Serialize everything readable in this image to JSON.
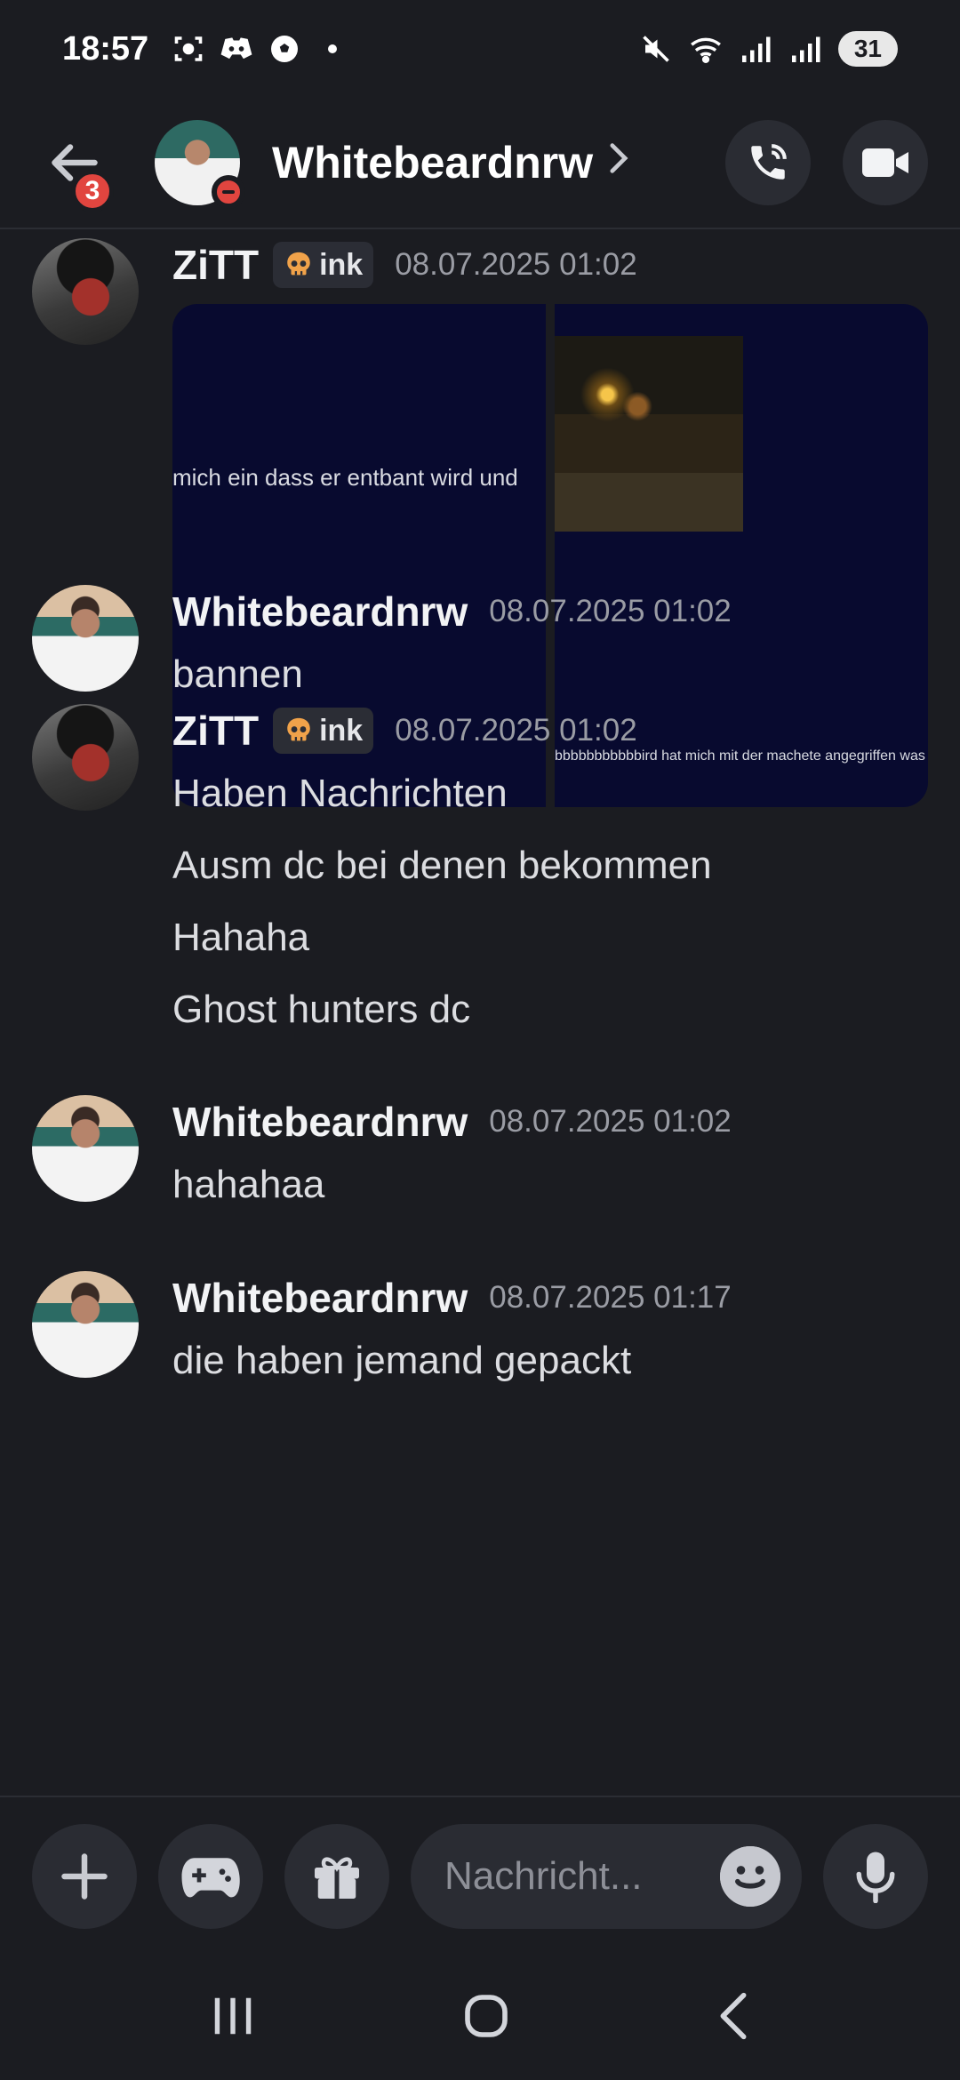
{
  "status_bar": {
    "time": "18:57",
    "battery": "31"
  },
  "header": {
    "title": "Whitebeardnrw",
    "unread_count": "3"
  },
  "messages": [
    {
      "author": "ZiTT",
      "tag": "ink",
      "timestamp": "08.07.2025 01:02",
      "images": [
        {
          "caption": "mich ein dass er entbant wird und"
        },
        {
          "caption": "bbbbbbbbbbbird hat mich mit der machete angegriffen was"
        }
      ]
    },
    {
      "author": "Whitebeardnrw",
      "timestamp": "08.07.2025 01:02",
      "lines": [
        "bannen"
      ]
    },
    {
      "author": "ZiTT",
      "tag": "ink",
      "timestamp": "08.07.2025 01:02",
      "lines": [
        "Haben Nachrichten",
        "Ausm dc bei denen bekommen",
        "Hahaha",
        "Ghost hunters dc"
      ]
    },
    {
      "author": "Whitebeardnrw",
      "timestamp": "08.07.2025 01:02",
      "lines": [
        "hahahaa"
      ]
    },
    {
      "author": "Whitebeardnrw",
      "timestamp": "08.07.2025 01:17",
      "lines": [
        "die haben jemand gepackt"
      ]
    }
  ],
  "composer": {
    "placeholder": "Nachricht..."
  },
  "colors": {
    "background": "#1b1c21",
    "dnd": "#e1453f",
    "badge": "#e1453f"
  }
}
